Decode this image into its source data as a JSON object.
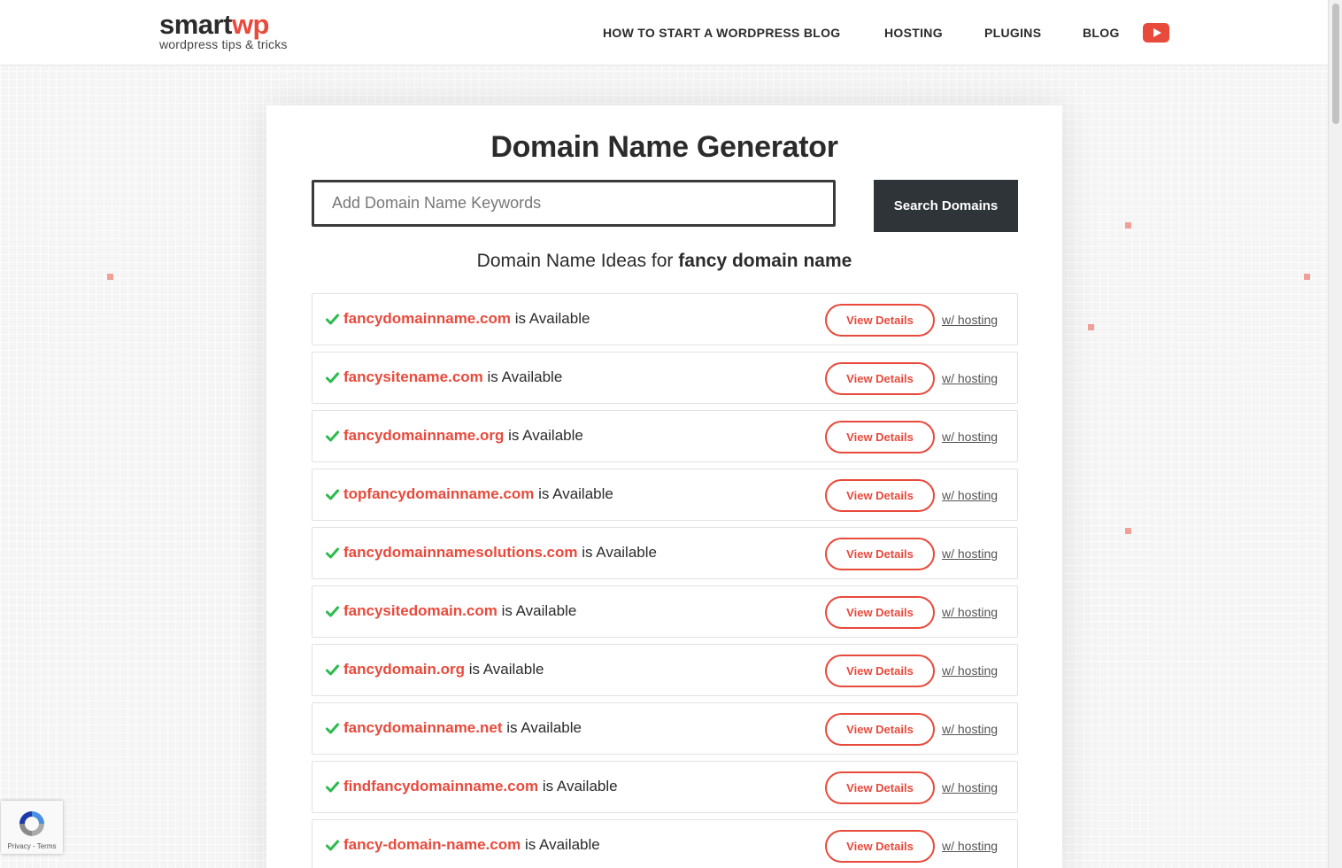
{
  "header": {
    "logo_main": "smart",
    "logo_accent": "wp",
    "logo_tagline": "wordpress tips & tricks",
    "nav": [
      {
        "label": "HOW TO START A WORDPRESS BLOG"
      },
      {
        "label": "HOSTING"
      },
      {
        "label": "PLUGINS"
      },
      {
        "label": "BLOG"
      }
    ],
    "youtube_icon": "youtube-play-icon"
  },
  "main": {
    "title": "Domain Name Generator",
    "search": {
      "placeholder": "Add Domain Name Keywords",
      "value": "",
      "button_label": "Search Domains"
    },
    "subtitle_prefix": "Domain Name Ideas for",
    "subtitle_query": "fancy domain name",
    "results": [
      {
        "domain": "fancydomainname.com",
        "status": "is Available",
        "button": "View Details",
        "link": "w/ hosting"
      },
      {
        "domain": "fancysitename.com",
        "status": "is Available",
        "button": "View Details",
        "link": "w/ hosting"
      },
      {
        "domain": "fancydomainname.org",
        "status": "is Available",
        "button": "View Details",
        "link": "w/ hosting"
      },
      {
        "domain": "topfancydomainname.com",
        "status": "is Available",
        "button": "View Details",
        "link": "w/ hosting"
      },
      {
        "domain": "fancydomainnamesolutions.com",
        "status": "is Available",
        "button": "View Details",
        "link": "w/ hosting"
      },
      {
        "domain": "fancysitedomain.com",
        "status": "is Available",
        "button": "View Details",
        "link": "w/ hosting"
      },
      {
        "domain": "fancydomain.org",
        "status": "is Available",
        "button": "View Details",
        "link": "w/ hosting"
      },
      {
        "domain": "fancydomainname.net",
        "status": "is Available",
        "button": "View Details",
        "link": "w/ hosting"
      },
      {
        "domain": "findfancydomainname.com",
        "status": "is Available",
        "button": "View Details",
        "link": "w/ hosting"
      },
      {
        "domain": "fancy-domain-name.com",
        "status": "is Available",
        "button": "View Details",
        "link": "w/ hosting"
      }
    ]
  },
  "recaptcha": {
    "links": "Privacy - Terms",
    "icon": "recaptcha-icon"
  },
  "colors": {
    "accent": "#e84a3c",
    "dark_button": "#2f3438",
    "check": "#2dba4e"
  }
}
